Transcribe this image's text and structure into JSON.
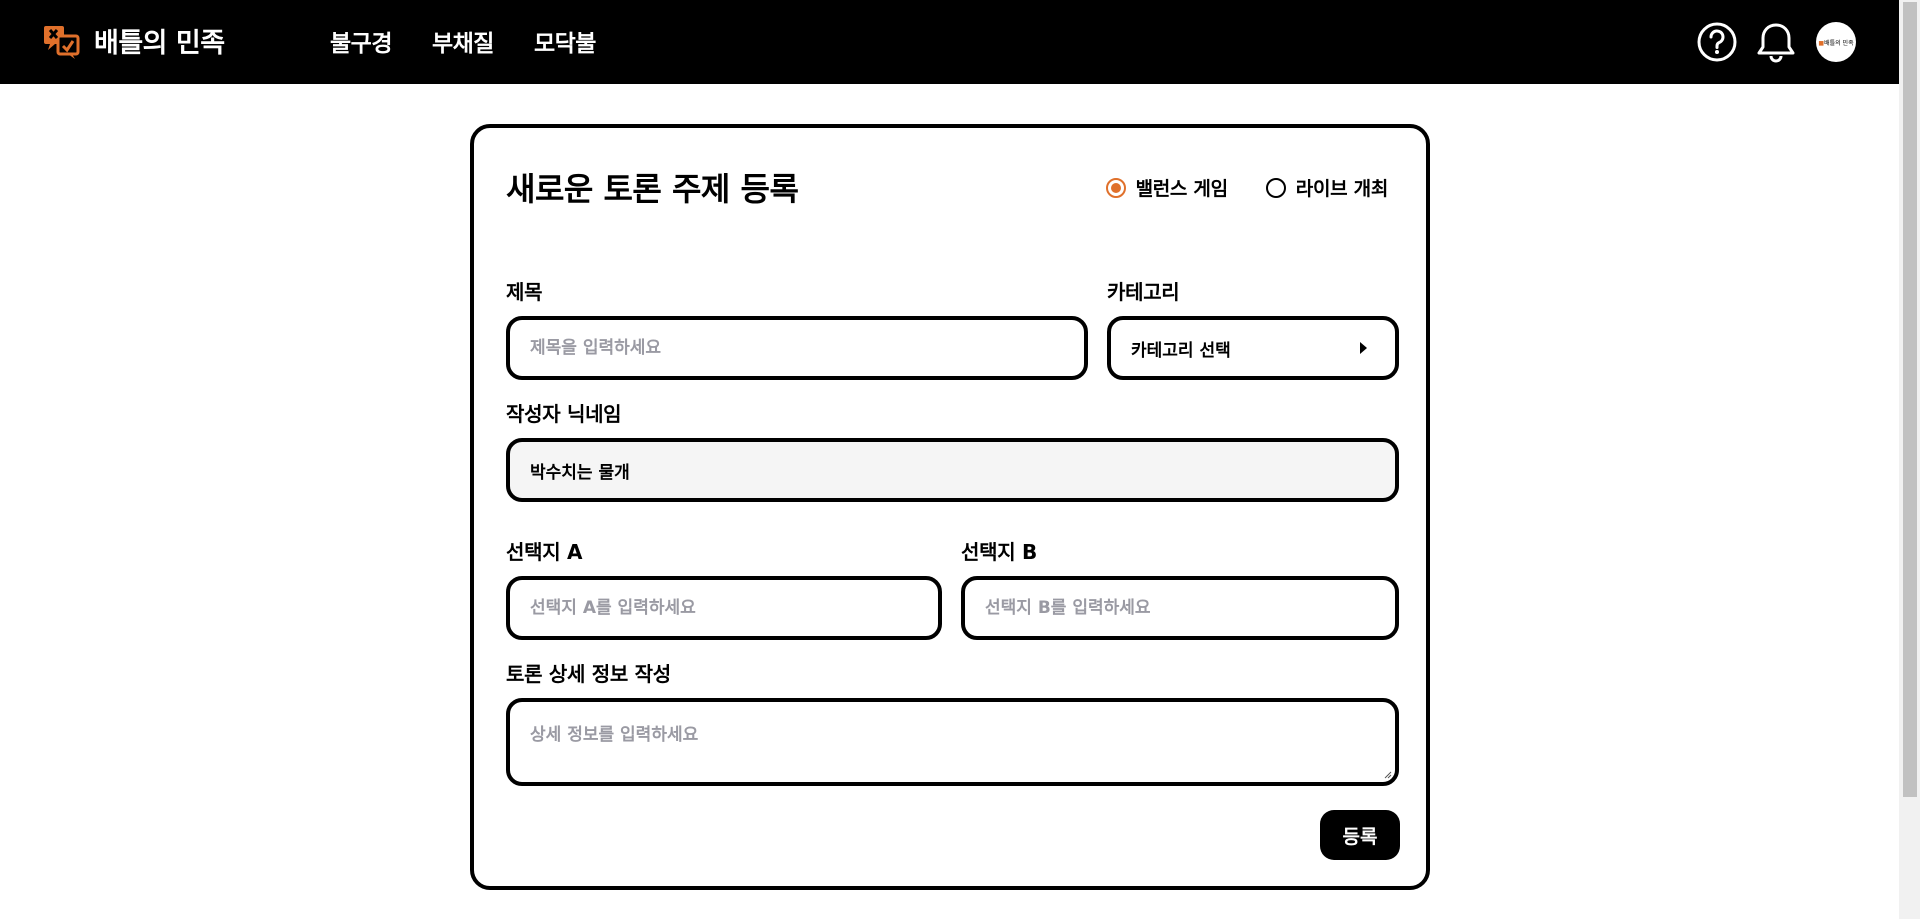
{
  "header": {
    "brand": "배틀의 민족",
    "nav": [
      "불구경",
      "부채질",
      "모닥불"
    ],
    "avatar_text": "배틀의 민족"
  },
  "form": {
    "title": "새로운 토론 주제 등록",
    "mode_options": [
      {
        "label": "밸런스 게임",
        "checked": true
      },
      {
        "label": "라이브 개최",
        "checked": false
      }
    ],
    "title_label": "제목",
    "title_placeholder": "제목을 입력하세요",
    "category_label": "카테고리",
    "category_value": "카테고리 선택",
    "author_label": "작성자 닉네임",
    "author_value": "박수치는 물개",
    "option_a_label": "선택지 A",
    "option_a_placeholder": "선택지 A를 입력하세요",
    "option_b_label": "선택지 B",
    "option_b_placeholder": "선택지 B를 입력하세요",
    "detail_label": "토론 상세 정보 작성",
    "detail_placeholder": "상세 정보를 입력하세요",
    "submit_label": "등록"
  },
  "colors": {
    "accent": "#e0702b",
    "header_bg": "#000000",
    "placeholder": "#9a9aa3"
  },
  "icons": {
    "logo": "battle-logo-icon",
    "help": "help-circle-icon",
    "notifications": "bell-icon",
    "category_caret": "caret-right-icon"
  }
}
